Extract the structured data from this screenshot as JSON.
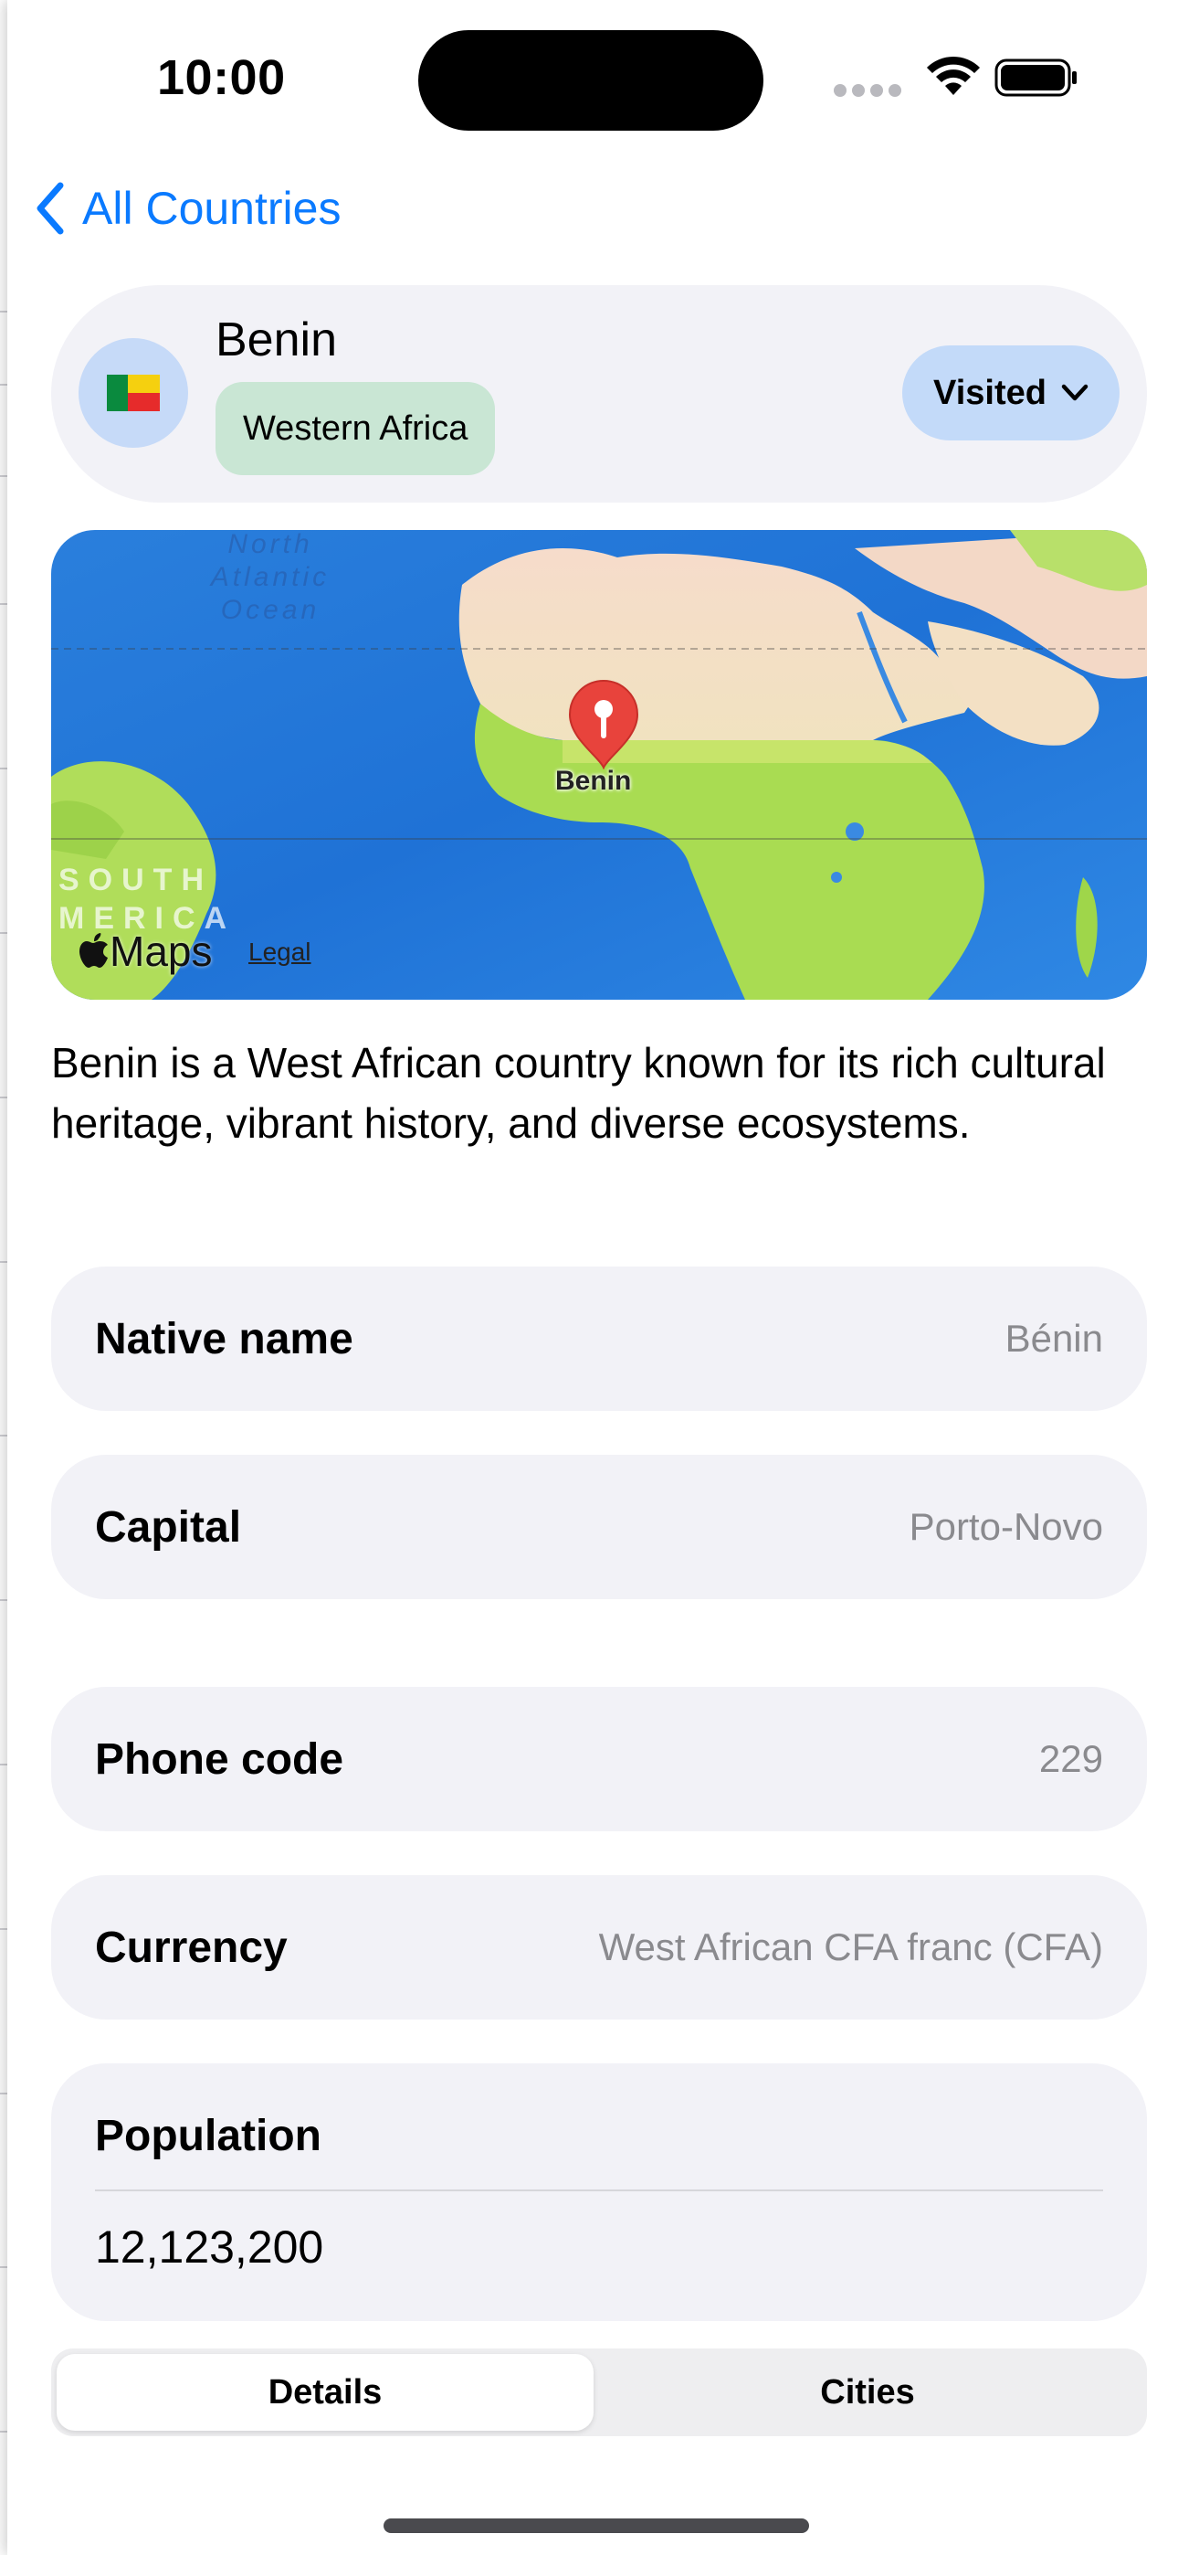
{
  "status_bar": {
    "time": "10:00",
    "icons": [
      "signal-dots-icon",
      "wifi-icon",
      "battery-icon"
    ]
  },
  "nav": {
    "back_label": "All Countries",
    "back_icon": "chevron-left-icon"
  },
  "country": {
    "name": "Benin",
    "flag": "🇧🇯",
    "region": "Western Africa",
    "status": "Visited",
    "status_icon": "chevron-down-icon"
  },
  "map": {
    "pin_label": "Benin",
    "ocean_label": "North\nAtlantic\nOcean",
    "continent_label": "SOUTH\nMERICA",
    "logo_text": "Maps",
    "legal_label": "Legal"
  },
  "description": "Benin is a West African country known for its rich cultural heritage, vibrant history, and diverse ecosystems.",
  "details": {
    "native_name": {
      "label": "Native name",
      "value": "Bénin"
    },
    "capital": {
      "label": "Capital",
      "value": "Porto-Novo"
    },
    "phone_code": {
      "label": "Phone code",
      "value": "229"
    },
    "currency": {
      "label": "Currency",
      "value": "West African CFA franc (CFA)"
    },
    "population": {
      "label": "Population",
      "value": "12,123,200"
    }
  },
  "tabs": {
    "details": "Details",
    "cities": "Cities"
  },
  "colors": {
    "accent": "#0a7aff",
    "card_bg": "#f2f2f7",
    "region_chip": "#c9e6d4",
    "status_button": "#c3daf9",
    "flag_circle": "#c6daf8"
  }
}
